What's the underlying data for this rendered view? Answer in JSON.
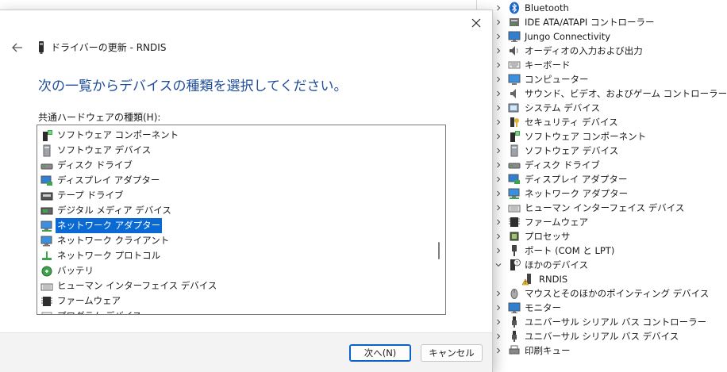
{
  "dialog": {
    "title": "ドライバーの更新 - RNDIS",
    "heading": "次の一覧からデバイスの種類を選択してください。",
    "list_label": "共通ハードウェアの種類(H):",
    "items": [
      {
        "label": "ソフトウェア コンポーネント",
        "icon": "software-component-icon"
      },
      {
        "label": "ソフトウェア デバイス",
        "icon": "software-device-icon"
      },
      {
        "label": "ディスク ドライブ",
        "icon": "disk-drive-icon"
      },
      {
        "label": "ディスプレイ アダプター",
        "icon": "display-adapter-icon"
      },
      {
        "label": "テープ ドライブ",
        "icon": "tape-drive-icon"
      },
      {
        "label": "デジタル メディア デバイス",
        "icon": "digital-media-icon"
      },
      {
        "label": "ネットワーク アダプター",
        "icon": "network-adapter-icon",
        "selected": true
      },
      {
        "label": "ネットワーク クライアント",
        "icon": "network-client-icon"
      },
      {
        "label": "ネットワーク プロトコル",
        "icon": "network-protocol-icon"
      },
      {
        "label": "バッテリ",
        "icon": "battery-icon"
      },
      {
        "label": "ヒューマン インターフェイス デバイス",
        "icon": "hid-icon"
      },
      {
        "label": "ファームウェア",
        "icon": "firmware-icon"
      },
      {
        "label": "プログラム デバイス…",
        "icon": "generic-device-icon"
      }
    ],
    "next_label": "次へ(N)",
    "cancel_label": "キャンセル"
  },
  "device_manager": {
    "items": [
      {
        "label": "Bluetooth",
        "icon": "bluetooth-icon"
      },
      {
        "label": "IDE ATA/ATAPI コントローラー",
        "icon": "ide-controller-icon"
      },
      {
        "label": "Jungo Connectivity",
        "icon": "monitor-icon"
      },
      {
        "label": "オーディオの入力および出力",
        "icon": "audio-icon"
      },
      {
        "label": "キーボード",
        "icon": "keyboard-icon"
      },
      {
        "label": "コンピューター",
        "icon": "computer-icon"
      },
      {
        "label": "サウンド、ビデオ、およびゲーム コントローラー",
        "icon": "sound-icon"
      },
      {
        "label": "システム デバイス",
        "icon": "system-device-icon"
      },
      {
        "label": "セキュリティ デバイス",
        "icon": "security-icon"
      },
      {
        "label": "ソフトウェア コンポーネント",
        "icon": "software-component-icon"
      },
      {
        "label": "ソフトウェア デバイス",
        "icon": "software-device-icon"
      },
      {
        "label": "ディスク ドライブ",
        "icon": "disk-drive-icon"
      },
      {
        "label": "ディスプレイ アダプター",
        "icon": "display-adapter-icon"
      },
      {
        "label": "ネットワーク アダプター",
        "icon": "network-adapter-icon"
      },
      {
        "label": "ヒューマン インターフェイス デバイス",
        "icon": "hid-icon"
      },
      {
        "label": "ファームウェア",
        "icon": "firmware-icon"
      },
      {
        "label": "プロセッサ",
        "icon": "processor-icon"
      },
      {
        "label": "ポート (COM と LPT)",
        "icon": "port-icon"
      },
      {
        "label": "ほかのデバイス",
        "icon": "other-device-icon",
        "expanded": true
      },
      {
        "label": "RNDIS",
        "icon": "warning-device-icon",
        "child": true
      },
      {
        "label": "マウスとそのほかのポインティング デバイス",
        "icon": "mouse-icon"
      },
      {
        "label": "モニター",
        "icon": "monitor-icon"
      },
      {
        "label": "ユニバーサル シリアル バス コントローラー",
        "icon": "usb-icon"
      },
      {
        "label": "ユニバーサル シリアル バス デバイス",
        "icon": "usb-icon"
      },
      {
        "label": "印刷キュー",
        "icon": "print-queue-icon"
      }
    ]
  },
  "colors": {
    "heading": "#1f4e98",
    "selection": "#0b69d4"
  }
}
